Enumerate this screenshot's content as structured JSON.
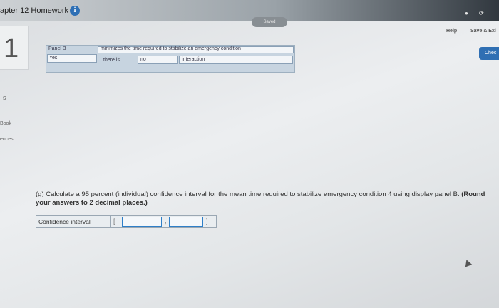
{
  "header": {
    "title": "apter 12 Homework",
    "info_icon": "info-icon",
    "saved_label": "Saved",
    "help_label": "Help",
    "save_exit_label": "Save & Exi",
    "check_label": "Chec"
  },
  "sidebar": {
    "question_number": "1",
    "dot": "s",
    "links": [
      "Book",
      "ences"
    ]
  },
  "panel": {
    "header_left": "Panel B",
    "header_right": "minimizes the time required to stabilize an emergency condition",
    "row_yes": "Yes",
    "row_there_is": "there is",
    "row_no": "no",
    "row_interaction": "interaction"
  },
  "question": {
    "text": "(g) Calculate a 95 percent (individual) confidence interval for the mean time required to stabilize emergency condition 4 using display panel B.",
    "bold": "(Round your answers to 2 decimal places.)"
  },
  "ci": {
    "label": "Confidence interval",
    "open_bracket": "[",
    "comma": ",",
    "close_bracket": "]",
    "lower_value": "",
    "upper_value": ""
  },
  "colors": {
    "accent": "#2f6fb3",
    "panel_bg": "#c7d4e0"
  }
}
